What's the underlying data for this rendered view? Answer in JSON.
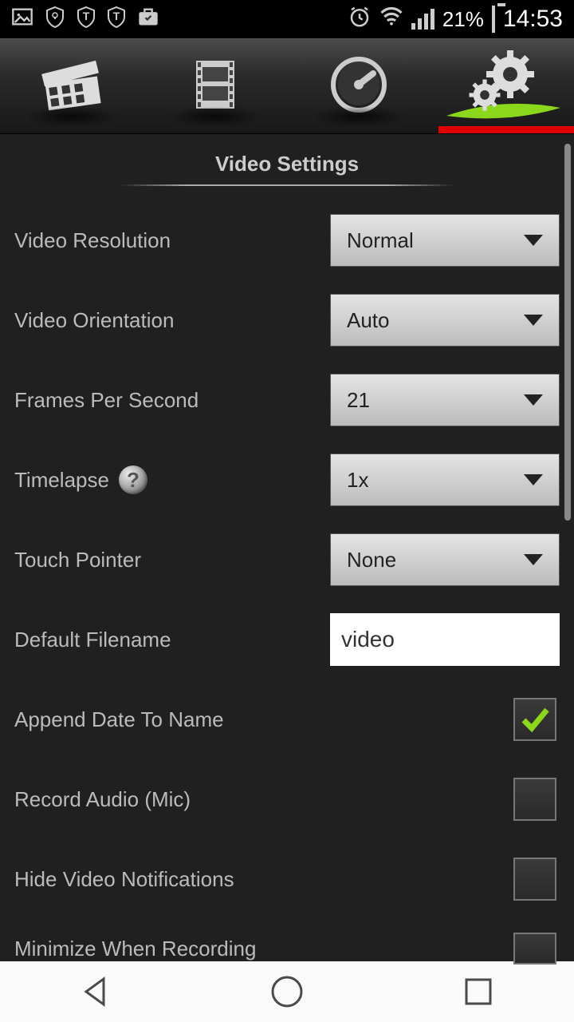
{
  "status": {
    "battery_pct": "21%",
    "time": "14:53"
  },
  "section_title": "Video Settings",
  "settings": {
    "video_resolution": {
      "label": "Video Resolution",
      "value": "Normal"
    },
    "video_orientation": {
      "label": "Video Orientation",
      "value": "Auto"
    },
    "frames_per_second": {
      "label": "Frames Per Second",
      "value": "21"
    },
    "timelapse": {
      "label": "Timelapse",
      "value": "1x"
    },
    "touch_pointer": {
      "label": "Touch Pointer",
      "value": "None"
    },
    "default_filename": {
      "label": "Default Filename",
      "value": "video"
    },
    "append_date": {
      "label": "Append Date To Name",
      "checked": true
    },
    "record_audio": {
      "label": "Record Audio (Mic)",
      "checked": false
    },
    "hide_notifications": {
      "label": "Hide Video Notifications",
      "checked": false
    },
    "minimize_recording": {
      "label": "Minimize When Recording",
      "checked": false
    }
  }
}
